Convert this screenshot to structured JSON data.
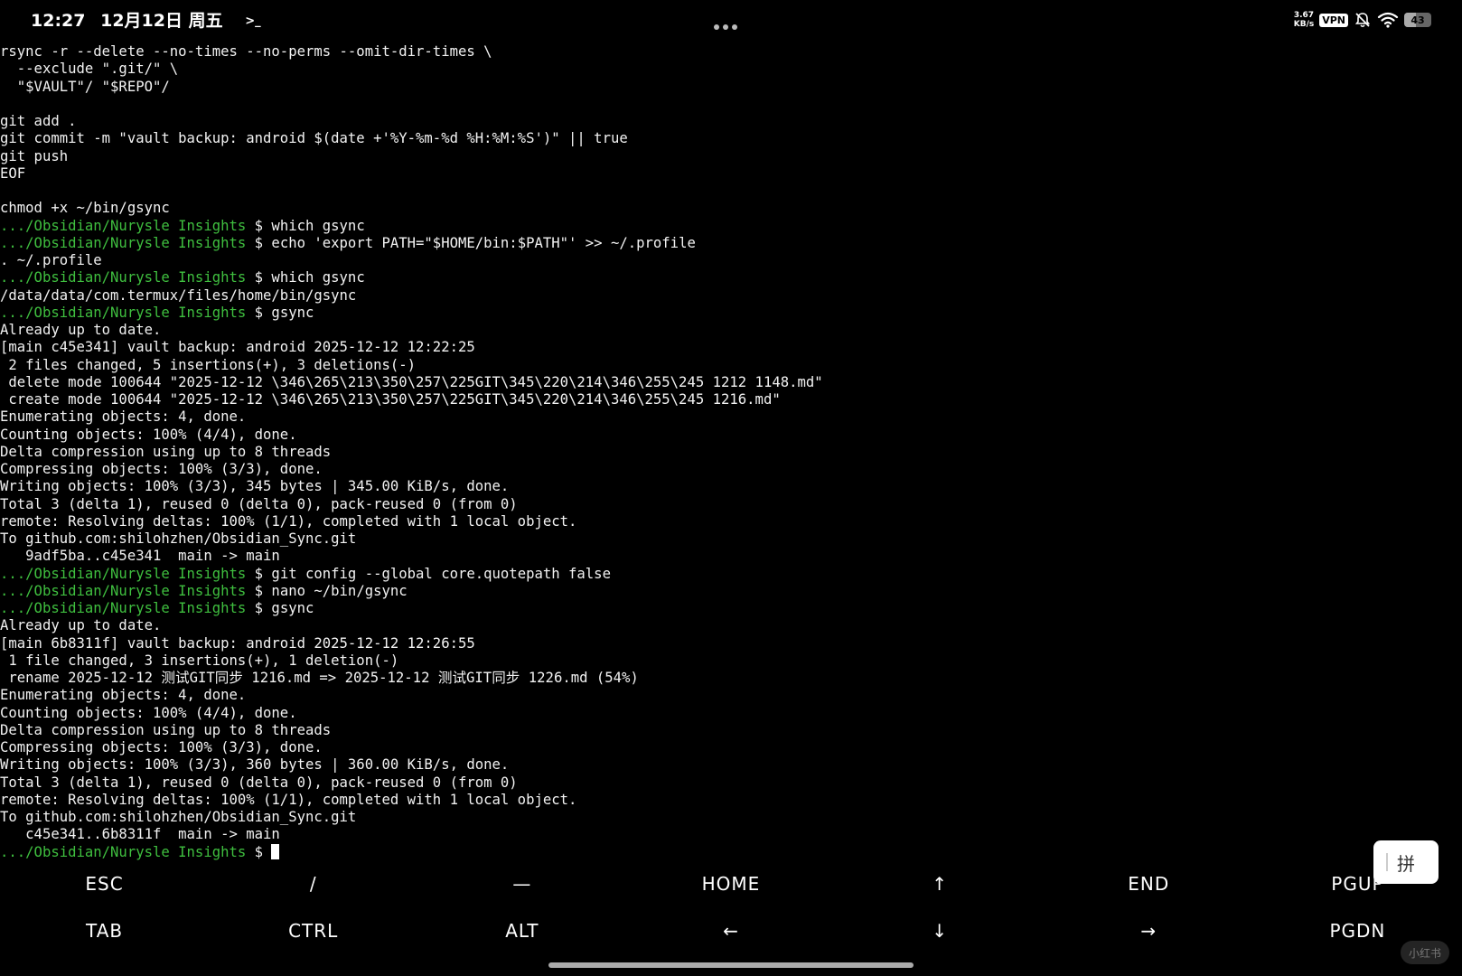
{
  "status_bar": {
    "time": "12:27",
    "date": "12月12日 周五",
    "app_icon": "terminal-prompt-icon",
    "app_icon_glyph": ">_",
    "net_speed_value": "3.67",
    "net_speed_unit": "KB/s",
    "vpn_label": "VPN",
    "battery_level": 43,
    "battery_label": "43"
  },
  "terminal": {
    "prompt_path": ".../Obsidian/Nurysle Insights",
    "lines": [
      {
        "p": "",
        "t": "rsync -r --delete --no-times --no-perms --omit-dir-times \\"
      },
      {
        "p": "",
        "t": "  --exclude \".git/\" \\"
      },
      {
        "p": "",
        "t": "  \"$VAULT\"/ \"$REPO\"/"
      },
      {
        "p": "",
        "t": ""
      },
      {
        "p": "",
        "t": "git add ."
      },
      {
        "p": "",
        "t": "git commit -m \"vault backup: android $(date +'%Y-%m-%d %H:%M:%S')\" || true"
      },
      {
        "p": "",
        "t": "git push"
      },
      {
        "p": "",
        "t": "EOF"
      },
      {
        "p": "",
        "t": ""
      },
      {
        "p": "",
        "t": "chmod +x ~/bin/gsync"
      },
      {
        "p": ".../Obsidian/Nurysle Insights",
        "t": " $ which gsync"
      },
      {
        "p": ".../Obsidian/Nurysle Insights",
        "t": " $ echo 'export PATH=\"$HOME/bin:$PATH\"' >> ~/.profile"
      },
      {
        "p": "",
        "t": ". ~/.profile"
      },
      {
        "p": ".../Obsidian/Nurysle Insights",
        "t": " $ which gsync"
      },
      {
        "p": "",
        "t": "/data/data/com.termux/files/home/bin/gsync"
      },
      {
        "p": ".../Obsidian/Nurysle Insights",
        "t": " $ gsync"
      },
      {
        "p": "",
        "t": "Already up to date."
      },
      {
        "p": "",
        "t": "[main c45e341] vault backup: android 2025-12-12 12:22:25"
      },
      {
        "p": "",
        "t": " 2 files changed, 5 insertions(+), 3 deletions(-)"
      },
      {
        "p": "",
        "t": " delete mode 100644 \"2025-12-12 \\346\\265\\213\\350\\257\\225GIT\\345\\220\\214\\346\\255\\245 1212 1148.md\""
      },
      {
        "p": "",
        "t": " create mode 100644 \"2025-12-12 \\346\\265\\213\\350\\257\\225GIT\\345\\220\\214\\346\\255\\245 1216.md\""
      },
      {
        "p": "",
        "t": "Enumerating objects: 4, done."
      },
      {
        "p": "",
        "t": "Counting objects: 100% (4/4), done."
      },
      {
        "p": "",
        "t": "Delta compression using up to 8 threads"
      },
      {
        "p": "",
        "t": "Compressing objects: 100% (3/3), done."
      },
      {
        "p": "",
        "t": "Writing objects: 100% (3/3), 345 bytes | 345.00 KiB/s, done."
      },
      {
        "p": "",
        "t": "Total 3 (delta 1), reused 0 (delta 0), pack-reused 0 (from 0)"
      },
      {
        "p": "",
        "t": "remote: Resolving deltas: 100% (1/1), completed with 1 local object."
      },
      {
        "p": "",
        "t": "To github.com:shilohzhen/Obsidian_Sync.git"
      },
      {
        "p": "",
        "t": "   9adf5ba..c45e341  main -> main"
      },
      {
        "p": ".../Obsidian/Nurysle Insights",
        "t": " $ git config --global core.quotepath false"
      },
      {
        "p": ".../Obsidian/Nurysle Insights",
        "t": " $ nano ~/bin/gsync"
      },
      {
        "p": ".../Obsidian/Nurysle Insights",
        "t": " $ gsync"
      },
      {
        "p": "",
        "t": "Already up to date."
      },
      {
        "p": "",
        "t": "[main 6b8311f] vault backup: android 2025-12-12 12:26:55"
      },
      {
        "p": "",
        "t": " 1 file changed, 3 insertions(+), 1 deletion(-)"
      },
      {
        "p": "",
        "t": " rename 2025-12-12 测试GIT同步 1216.md => 2025-12-12 测试GIT同步 1226.md (54%)"
      },
      {
        "p": "",
        "t": "Enumerating objects: 4, done."
      },
      {
        "p": "",
        "t": "Counting objects: 100% (4/4), done."
      },
      {
        "p": "",
        "t": "Delta compression using up to 8 threads"
      },
      {
        "p": "",
        "t": "Compressing objects: 100% (3/3), done."
      },
      {
        "p": "",
        "t": "Writing objects: 100% (3/3), 360 bytes | 360.00 KiB/s, done."
      },
      {
        "p": "",
        "t": "Total 3 (delta 1), reused 0 (delta 0), pack-reused 0 (from 0)"
      },
      {
        "p": "",
        "t": "remote: Resolving deltas: 100% (1/1), completed with 1 local object."
      },
      {
        "p": "",
        "t": "To github.com:shilohzhen/Obsidian_Sync.git"
      },
      {
        "p": "",
        "t": "   c45e341..6b8311f  main -> main"
      }
    ],
    "current_prompt": " $ "
  },
  "extra_keys": {
    "row1": [
      "ESC",
      "/",
      "—",
      "HOME",
      "↑",
      "END",
      "PGUP"
    ],
    "row2": [
      "TAB",
      "CTRL",
      "ALT",
      "←",
      "↓",
      "→",
      "PGDN"
    ]
  },
  "ime_button": {
    "label": "拼"
  },
  "watermark": {
    "label": "小红书"
  },
  "colors": {
    "background": "#000000",
    "text": "#f2f2f2",
    "prompt_path": "#3fbf3f",
    "ime_button_bg": "#ffffff"
  }
}
